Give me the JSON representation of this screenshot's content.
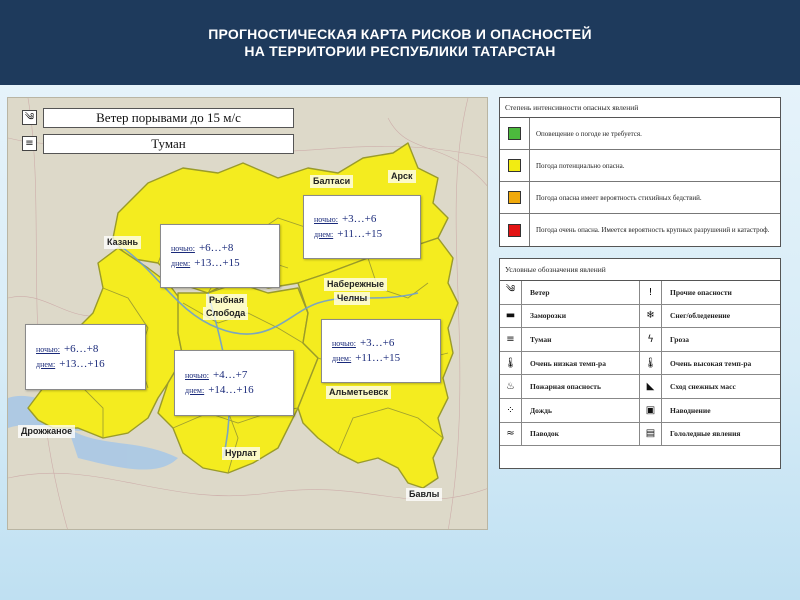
{
  "header": {
    "title_line1": "ПРОГНОСТИЧЕСКАЯ КАРТА РИСКОВ И ОПАСНОСТЕЙ",
    "title_line2": "НА ТЕРРИТОРИИ РЕСПУБЛИКИ ТАТАРСТАН"
  },
  "map": {
    "phenomena": [
      {
        "icon": "wind-icon",
        "glyph": "༄",
        "label": "Ветер порывами до 15 м/с"
      },
      {
        "icon": "fog-icon",
        "glyph": "≡",
        "label": "Туман"
      }
    ],
    "cities": [
      "Балтаси",
      "Арск",
      "Казань",
      "Набережные",
      "Челны",
      "Рыбная",
      "Слобода",
      "Альметьевск",
      "Дрожжаное",
      "Нурлат",
      "Бавлы"
    ],
    "temp_labels": {
      "night": "ночью:",
      "day": "днем:"
    },
    "zones": [
      {
        "night": "+3…+6",
        "day": "+11…+15"
      },
      {
        "night": "+6…+8",
        "day": "+13…+15"
      },
      {
        "night": "+3…+6",
        "day": "+11…+15"
      },
      {
        "night": "+6…+8",
        "day": "+13…+16"
      },
      {
        "night": "+4…+7",
        "day": "+14…+16"
      }
    ],
    "colors": {
      "region_fill": "#f4ec1f",
      "region_border": "#9a9b2a",
      "background": "#ddd9c9",
      "water": "#a9c8e6"
    }
  },
  "intensity_legend": {
    "title": "Степень интенсивности опасных явлений",
    "rows": [
      {
        "color": "#4cba3d",
        "text": "Оповещение о погоде не требуется."
      },
      {
        "color": "#f2ec12",
        "text": "Погода потенциально опасна."
      },
      {
        "color": "#f0a90b",
        "text": "Погода опасна имеет вероятность стихийных бедствий."
      },
      {
        "color": "#e31414",
        "text": "Погода очень опасна. Имеется вероятность крупных разрушений и катастроф."
      }
    ]
  },
  "symbols_legend": {
    "title": "Условные обозначения явлений",
    "items": [
      {
        "icon": "wind-icon",
        "glyph": "༄",
        "label": "Ветер"
      },
      {
        "icon": "other-danger-icon",
        "glyph": "!",
        "label": "Прочие опасности"
      },
      {
        "icon": "frost-icon",
        "glyph": "▬",
        "label": "Заморозки"
      },
      {
        "icon": "snow-ice-icon",
        "glyph": "❄",
        "label": "Снег/обледенение"
      },
      {
        "icon": "fog-icon",
        "glyph": "≡",
        "label": "Туман"
      },
      {
        "icon": "thunderstorm-icon",
        "glyph": "ϟ",
        "label": "Гроза"
      },
      {
        "icon": "low-temperature-icon",
        "glyph": "🌡",
        "label": "Очень низкая темп-ра"
      },
      {
        "icon": "high-temperature-icon",
        "glyph": "🌡",
        "label": "Очень высокая темп-ра"
      },
      {
        "icon": "fire-danger-icon",
        "glyph": "♨",
        "label": "Пожарная опасность"
      },
      {
        "icon": "avalanche-icon",
        "glyph": "◣",
        "label": "Сход снежных масс"
      },
      {
        "icon": "rain-icon",
        "glyph": "⁘",
        "label": "Дождь"
      },
      {
        "icon": "flood-icon",
        "glyph": "▣",
        "label": "Наводнение"
      },
      {
        "icon": "flood-wave-icon",
        "glyph": "≈",
        "label": "Паводок"
      },
      {
        "icon": "ice-phenomena-icon",
        "glyph": "▤",
        "label": "Гололедные явления"
      }
    ]
  }
}
